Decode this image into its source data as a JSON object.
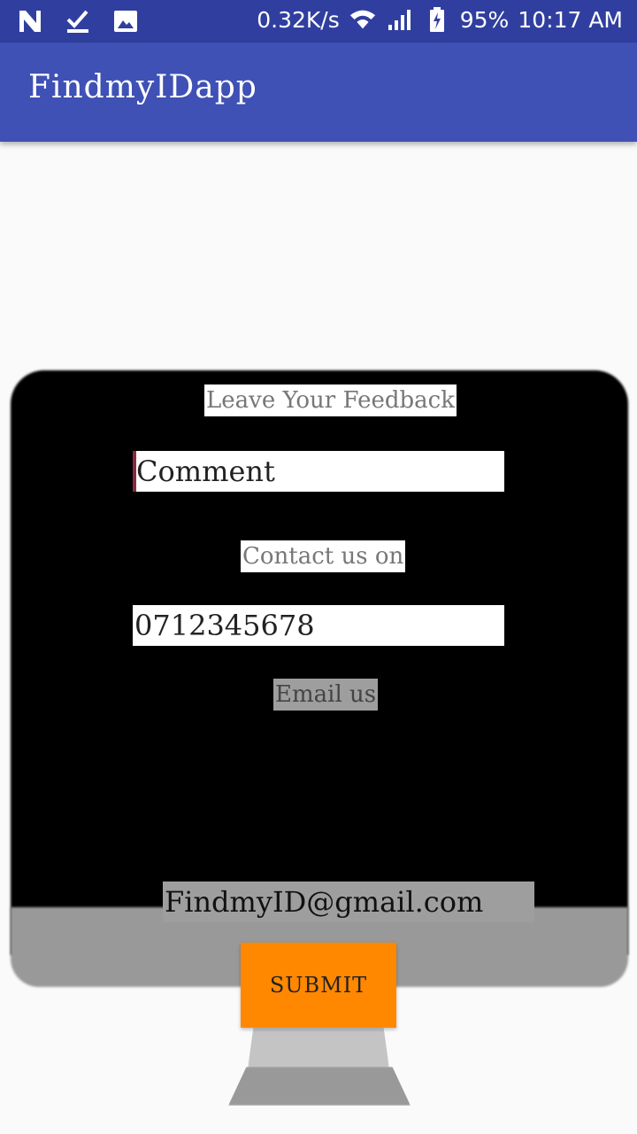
{
  "status_bar": {
    "icons_left": [
      "n-notification-icon",
      "download-done-icon",
      "image-icon"
    ],
    "speed": "0.32K/s",
    "battery": "95%",
    "time": "10:17 AM"
  },
  "app_bar": {
    "title": "FindmyIDapp"
  },
  "form": {
    "feedback_label": "Leave Your Feedback",
    "comment_value": "Comment",
    "contact_label": "Contact us on",
    "phone_value": "0712345678",
    "email_label": "Email us",
    "email_value": "FindmyID@gmail.com",
    "submit_label": "SUBMIT"
  },
  "colors": {
    "status_bar": "#303f9f",
    "app_bar": "#3f51b5",
    "submit": "#ff8800"
  }
}
